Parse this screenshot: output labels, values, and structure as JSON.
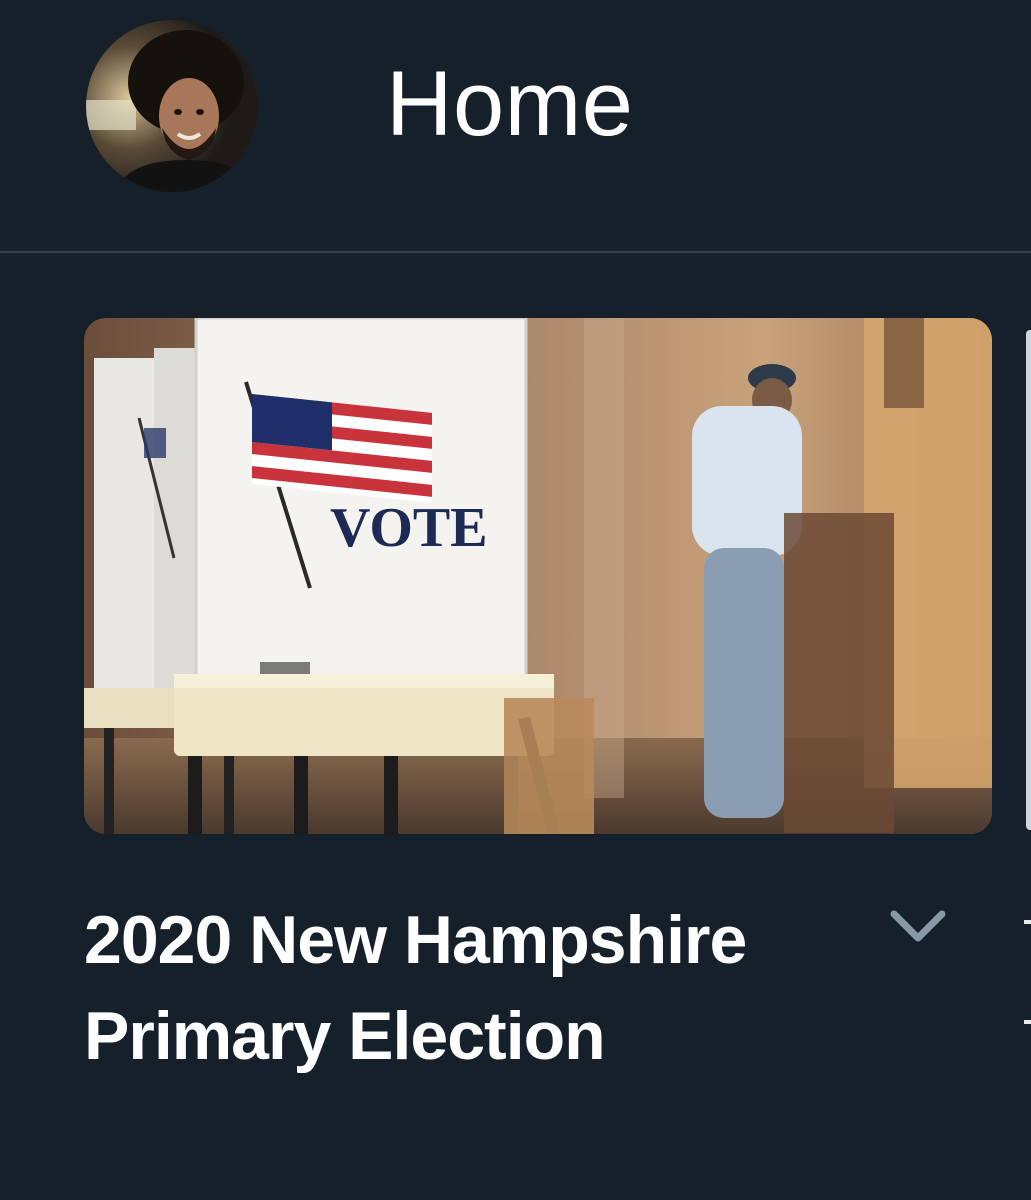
{
  "header": {
    "title": "Home",
    "avatar_icon": "user-avatar"
  },
  "trend_card": {
    "image_icon": "voting-booth-photo",
    "booth_text": "VOTE",
    "title": "2020 New Hampshire Primary Election",
    "menu_icon": "chevron-down-icon"
  },
  "colors": {
    "background": "#15202b",
    "divider": "#38444d",
    "text": "#ffffff",
    "chevron": "#8899a6"
  }
}
